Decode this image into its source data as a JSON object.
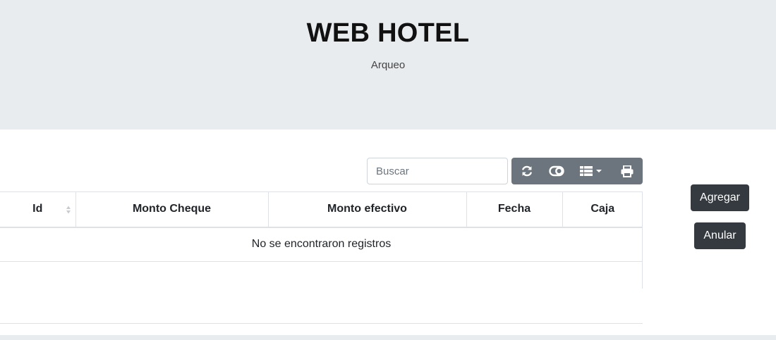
{
  "header": {
    "title": "WEB HOTEL",
    "subtitle": "Arqueo"
  },
  "toolbar": {
    "search_placeholder": "Buscar",
    "buttons": [
      {
        "name": "refresh",
        "icon": "refresh-icon"
      },
      {
        "name": "toggle",
        "icon": "toggle-icon"
      },
      {
        "name": "columns",
        "icon": "columns-icon"
      },
      {
        "name": "print",
        "icon": "print-icon"
      }
    ]
  },
  "table": {
    "columns": [
      "Id",
      "Monto Cheque",
      "Monto efectivo",
      "Fecha",
      "Caja"
    ],
    "empty_message": "No se encontraron registros"
  },
  "actions": {
    "add_label": "Agregar",
    "cancel_label": "Anular"
  },
  "colors": {
    "header_bg": "#e9ecef",
    "toolbar_bg": "#6c757d",
    "button_dark": "#343a40"
  }
}
